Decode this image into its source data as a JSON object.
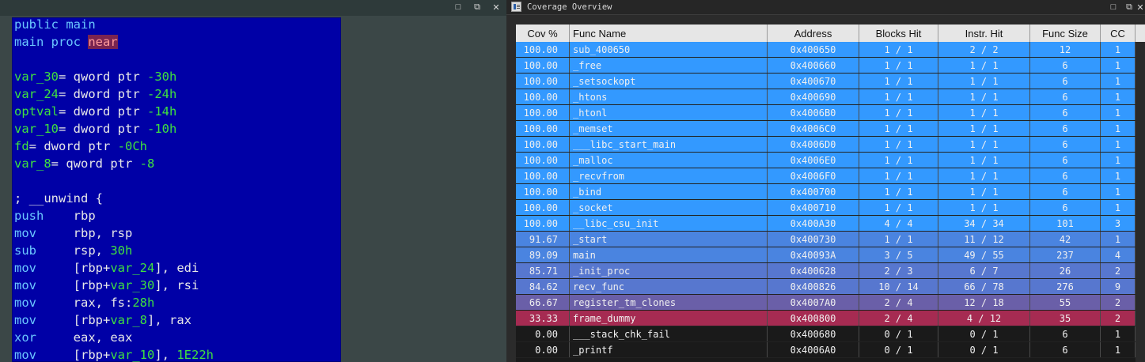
{
  "left_pane": {
    "lines": [
      [
        {
          "t": "public main",
          "c": "kw"
        }
      ],
      [
        {
          "t": "main proc ",
          "c": "kw"
        },
        {
          "t": "near",
          "c": "near"
        }
      ],
      [],
      [
        {
          "t": "var_30",
          "c": "gv"
        },
        {
          "t": "= ",
          "c": "plain"
        },
        {
          "t": "qword ptr ",
          "c": "ws"
        },
        {
          "t": "-30h",
          "c": "num"
        }
      ],
      [
        {
          "t": "var_24",
          "c": "gv"
        },
        {
          "t": "= ",
          "c": "plain"
        },
        {
          "t": "dword ptr ",
          "c": "ws"
        },
        {
          "t": "-24h",
          "c": "num"
        }
      ],
      [
        {
          "t": "optval",
          "c": "gv"
        },
        {
          "t": "= ",
          "c": "plain"
        },
        {
          "t": "dword ptr ",
          "c": "ws"
        },
        {
          "t": "-14h",
          "c": "num"
        }
      ],
      [
        {
          "t": "var_10",
          "c": "gv"
        },
        {
          "t": "= ",
          "c": "plain"
        },
        {
          "t": "dword ptr ",
          "c": "ws"
        },
        {
          "t": "-10h",
          "c": "num"
        }
      ],
      [
        {
          "t": "fd",
          "c": "gv"
        },
        {
          "t": "= ",
          "c": "plain"
        },
        {
          "t": "dword ptr ",
          "c": "ws"
        },
        {
          "t": "-0Ch",
          "c": "num"
        }
      ],
      [
        {
          "t": "var_8",
          "c": "gv"
        },
        {
          "t": "= ",
          "c": "plain"
        },
        {
          "t": "qword ptr ",
          "c": "ws"
        },
        {
          "t": "-8",
          "c": "num"
        }
      ],
      [],
      [
        {
          "t": "; __unwind {",
          "c": "cmt"
        }
      ],
      [
        {
          "t": "push    ",
          "c": "kw"
        },
        {
          "t": "rbp",
          "c": "plain"
        }
      ],
      [
        {
          "t": "mov     ",
          "c": "kw"
        },
        {
          "t": "rbp, rsp",
          "c": "plain"
        }
      ],
      [
        {
          "t": "sub     ",
          "c": "kw"
        },
        {
          "t": "rsp, ",
          "c": "plain"
        },
        {
          "t": "30h",
          "c": "num"
        }
      ],
      [
        {
          "t": "mov     ",
          "c": "kw"
        },
        {
          "t": "[rbp+",
          "c": "plain"
        },
        {
          "t": "var_24",
          "c": "gv"
        },
        {
          "t": "], edi",
          "c": "plain"
        }
      ],
      [
        {
          "t": "mov     ",
          "c": "kw"
        },
        {
          "t": "[rbp+",
          "c": "plain"
        },
        {
          "t": "var_30",
          "c": "gv"
        },
        {
          "t": "], rsi",
          "c": "plain"
        }
      ],
      [
        {
          "t": "mov     ",
          "c": "kw"
        },
        {
          "t": "rax, fs:",
          "c": "plain"
        },
        {
          "t": "28h",
          "c": "num"
        }
      ],
      [
        {
          "t": "mov     ",
          "c": "kw"
        },
        {
          "t": "[rbp+",
          "c": "plain"
        },
        {
          "t": "var_8",
          "c": "gv"
        },
        {
          "t": "], rax",
          "c": "plain"
        }
      ],
      [
        {
          "t": "xor     ",
          "c": "kw"
        },
        {
          "t": "eax, eax",
          "c": "plain"
        }
      ],
      [
        {
          "t": "mov     ",
          "c": "kw"
        },
        {
          "t": "[rbp+",
          "c": "plain"
        },
        {
          "t": "var_10",
          "c": "gv"
        },
        {
          "t": "], ",
          "c": "plain"
        },
        {
          "t": "1E22h",
          "c": "num"
        }
      ]
    ]
  },
  "coverage": {
    "title": "Coverage Overview",
    "columns": [
      "Cov %",
      "Func Name",
      "Address",
      "Blocks Hit",
      "Instr. Hit",
      "Func Size",
      "CC"
    ],
    "colors": {
      "full": "#3399ff",
      "high": "#4a84e0",
      "mid1": "#5777cf",
      "mid2": "#6a5fa8",
      "low": "#a62b52",
      "none": "#1a1a1a"
    },
    "rows": [
      {
        "cov": "100.00",
        "name": "sub_400650",
        "addr": "0x400650",
        "blocks": "1 / 1",
        "instr": "2 / 2",
        "size": "12",
        "cc": "1",
        "color": "full"
      },
      {
        "cov": "100.00",
        "name": "_free",
        "addr": "0x400660",
        "blocks": "1 / 1",
        "instr": "1 / 1",
        "size": "6",
        "cc": "1",
        "color": "full"
      },
      {
        "cov": "100.00",
        "name": "_setsockopt",
        "addr": "0x400670",
        "blocks": "1 / 1",
        "instr": "1 / 1",
        "size": "6",
        "cc": "1",
        "color": "full"
      },
      {
        "cov": "100.00",
        "name": "_htons",
        "addr": "0x400690",
        "blocks": "1 / 1",
        "instr": "1 / 1",
        "size": "6",
        "cc": "1",
        "color": "full"
      },
      {
        "cov": "100.00",
        "name": "_htonl",
        "addr": "0x4006B0",
        "blocks": "1 / 1",
        "instr": "1 / 1",
        "size": "6",
        "cc": "1",
        "color": "full"
      },
      {
        "cov": "100.00",
        "name": "_memset",
        "addr": "0x4006C0",
        "blocks": "1 / 1",
        "instr": "1 / 1",
        "size": "6",
        "cc": "1",
        "color": "full"
      },
      {
        "cov": "100.00",
        "name": "___libc_start_main",
        "addr": "0x4006D0",
        "blocks": "1 / 1",
        "instr": "1 / 1",
        "size": "6",
        "cc": "1",
        "color": "full"
      },
      {
        "cov": "100.00",
        "name": "_malloc",
        "addr": "0x4006E0",
        "blocks": "1 / 1",
        "instr": "1 / 1",
        "size": "6",
        "cc": "1",
        "color": "full"
      },
      {
        "cov": "100.00",
        "name": "_recvfrom",
        "addr": "0x4006F0",
        "blocks": "1 / 1",
        "instr": "1 / 1",
        "size": "6",
        "cc": "1",
        "color": "full"
      },
      {
        "cov": "100.00",
        "name": "_bind",
        "addr": "0x400700",
        "blocks": "1 / 1",
        "instr": "1 / 1",
        "size": "6",
        "cc": "1",
        "color": "full"
      },
      {
        "cov": "100.00",
        "name": "_socket",
        "addr": "0x400710",
        "blocks": "1 / 1",
        "instr": "1 / 1",
        "size": "6",
        "cc": "1",
        "color": "full"
      },
      {
        "cov": "100.00",
        "name": "__libc_csu_init",
        "addr": "0x400A30",
        "blocks": "4 / 4",
        "instr": "34 / 34",
        "size": "101",
        "cc": "3",
        "color": "full"
      },
      {
        "cov": "91.67",
        "name": "_start",
        "addr": "0x400730",
        "blocks": "1 / 1",
        "instr": "11 / 12",
        "size": "42",
        "cc": "1",
        "color": "high"
      },
      {
        "cov": "89.09",
        "name": "main",
        "addr": "0x40093A",
        "blocks": "3 / 5",
        "instr": "49 / 55",
        "size": "237",
        "cc": "4",
        "color": "high"
      },
      {
        "cov": "85.71",
        "name": "_init_proc",
        "addr": "0x400628",
        "blocks": "2 / 3",
        "instr": "6 / 7",
        "size": "26",
        "cc": "2",
        "color": "mid1"
      },
      {
        "cov": "84.62",
        "name": "recv_func",
        "addr": "0x400826",
        "blocks": "10 / 14",
        "instr": "66 / 78",
        "size": "276",
        "cc": "9",
        "color": "mid1"
      },
      {
        "cov": "66.67",
        "name": "register_tm_clones",
        "addr": "0x4007A0",
        "blocks": "2 / 4",
        "instr": "12 / 18",
        "size": "55",
        "cc": "2",
        "color": "mid2"
      },
      {
        "cov": "33.33",
        "name": "frame_dummy",
        "addr": "0x400800",
        "blocks": "2 / 4",
        "instr": "4 / 12",
        "size": "35",
        "cc": "2",
        "color": "low"
      },
      {
        "cov": "0.00",
        "name": "___stack_chk_fail",
        "addr": "0x400680",
        "blocks": "0 / 1",
        "instr": "0 / 1",
        "size": "6",
        "cc": "1",
        "color": "none"
      },
      {
        "cov": "0.00",
        "name": "_printf",
        "addr": "0x4006A0",
        "blocks": "0 / 1",
        "instr": "0 / 1",
        "size": "6",
        "cc": "1",
        "color": "none"
      }
    ]
  },
  "icons": {
    "restore": "restore-icon",
    "float": "float-icon",
    "close": "close-icon"
  }
}
